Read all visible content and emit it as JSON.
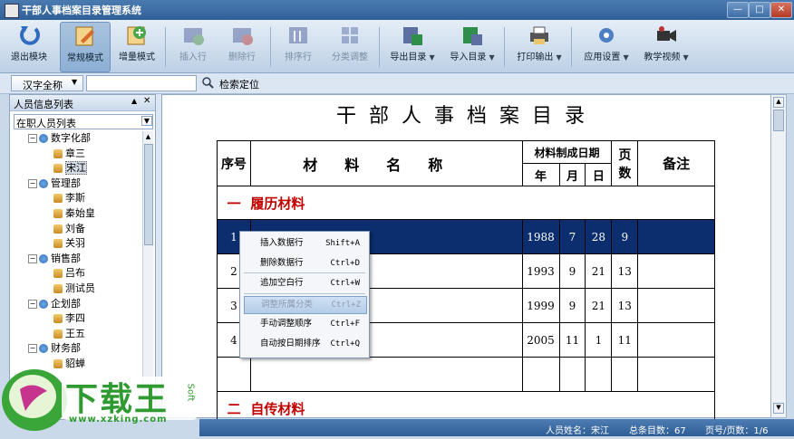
{
  "window": {
    "title": "干部人事档案目录管理系统"
  },
  "toolbar": {
    "items": [
      {
        "label": "退出模块",
        "icon": "exit-icon"
      },
      {
        "label": "常规模式",
        "icon": "edit-mode-icon",
        "active": true
      },
      {
        "label": "增量模式",
        "icon": "add-mode-icon"
      },
      {
        "label": "插入行",
        "icon": "insert-row-icon",
        "disabled": true
      },
      {
        "label": "删除行",
        "icon": "delete-row-icon",
        "disabled": true
      },
      {
        "label": "排序行",
        "icon": "sort-row-icon",
        "disabled": true
      },
      {
        "label": "分类调整",
        "icon": "category-icon",
        "disabled": true
      },
      {
        "label": "导出目录",
        "icon": "export-icon"
      },
      {
        "label": "导入目录",
        "icon": "import-icon"
      },
      {
        "label": "打印输出",
        "icon": "printer-icon"
      },
      {
        "label": "应用设置",
        "icon": "settings-icon"
      },
      {
        "label": "教学视频",
        "icon": "video-icon"
      }
    ]
  },
  "filter": {
    "select_value": "汉字全称",
    "input_value": "",
    "search_label": "检索定位"
  },
  "left_panel": {
    "title": "人员信息列表",
    "list_select": "在职人员列表",
    "tree": [
      {
        "label": "数字化部",
        "level": 0
      },
      {
        "label": "章三",
        "level": 1
      },
      {
        "label": "宋江",
        "level": 1,
        "selected": true
      },
      {
        "label": "管理部",
        "level": 0
      },
      {
        "label": "李斯",
        "level": 1
      },
      {
        "label": "秦始皇",
        "level": 1
      },
      {
        "label": "刘备",
        "level": 1
      },
      {
        "label": "关羽",
        "level": 1
      },
      {
        "label": "销售部",
        "level": 0
      },
      {
        "label": "吕布",
        "level": 1
      },
      {
        "label": "测试员",
        "level": 1
      },
      {
        "label": "企划部",
        "level": 0
      },
      {
        "label": "李四",
        "level": 1
      },
      {
        "label": "王五",
        "level": 1
      },
      {
        "label": "财务部",
        "level": 0
      },
      {
        "label": "貂蝉",
        "level": 1
      }
    ]
  },
  "document": {
    "title": "干部人事档案目录",
    "headers": {
      "seq": "序号",
      "name": "材料名称",
      "date": "材料制成日期",
      "year": "年",
      "month": "月",
      "day": "日",
      "pages": "页数",
      "remark": "备注"
    },
    "section1": {
      "num": "一",
      "title": "履历材料"
    },
    "rows": [
      {
        "seq": "1",
        "name": "",
        "year": "1988",
        "month": "7",
        "day": "28",
        "pages": "9",
        "selected": true
      },
      {
        "seq": "2",
        "name": "",
        "year": "1993",
        "month": "9",
        "day": "21",
        "pages": "13"
      },
      {
        "seq": "3",
        "name": "",
        "year": "1999",
        "month": "9",
        "day": "21",
        "pages": "13"
      },
      {
        "seq": "4",
        "name": "",
        "year": "2005",
        "month": "11",
        "day": "1",
        "pages": "11"
      }
    ],
    "section2": {
      "num": "二",
      "title": "自传材料"
    }
  },
  "context_menu": {
    "items": [
      {
        "label": "插入数据行",
        "key": "Shift+A"
      },
      {
        "label": "删除数据行",
        "key": "Ctrl+D"
      },
      {
        "label": "追加空白行",
        "key": "Ctrl+W"
      },
      {
        "label": "调整所属分类",
        "key": "Ctrl+Z",
        "disabled": true
      },
      {
        "label": "手动调整顺序",
        "key": "Ctrl+F"
      },
      {
        "label": "自动按日期排序",
        "key": "Ctrl+Q"
      }
    ]
  },
  "status": {
    "name": "人员姓名：宋江",
    "total": "总条目数：67",
    "page": "页号/页数：1/6"
  },
  "logo": {
    "text": "下载王",
    "site": "www.xzking.com",
    "soft": "Soft"
  },
  "colors": {
    "accent": "#0c2d6e",
    "section": "#c00000",
    "status_bg": "#2e5d95"
  }
}
